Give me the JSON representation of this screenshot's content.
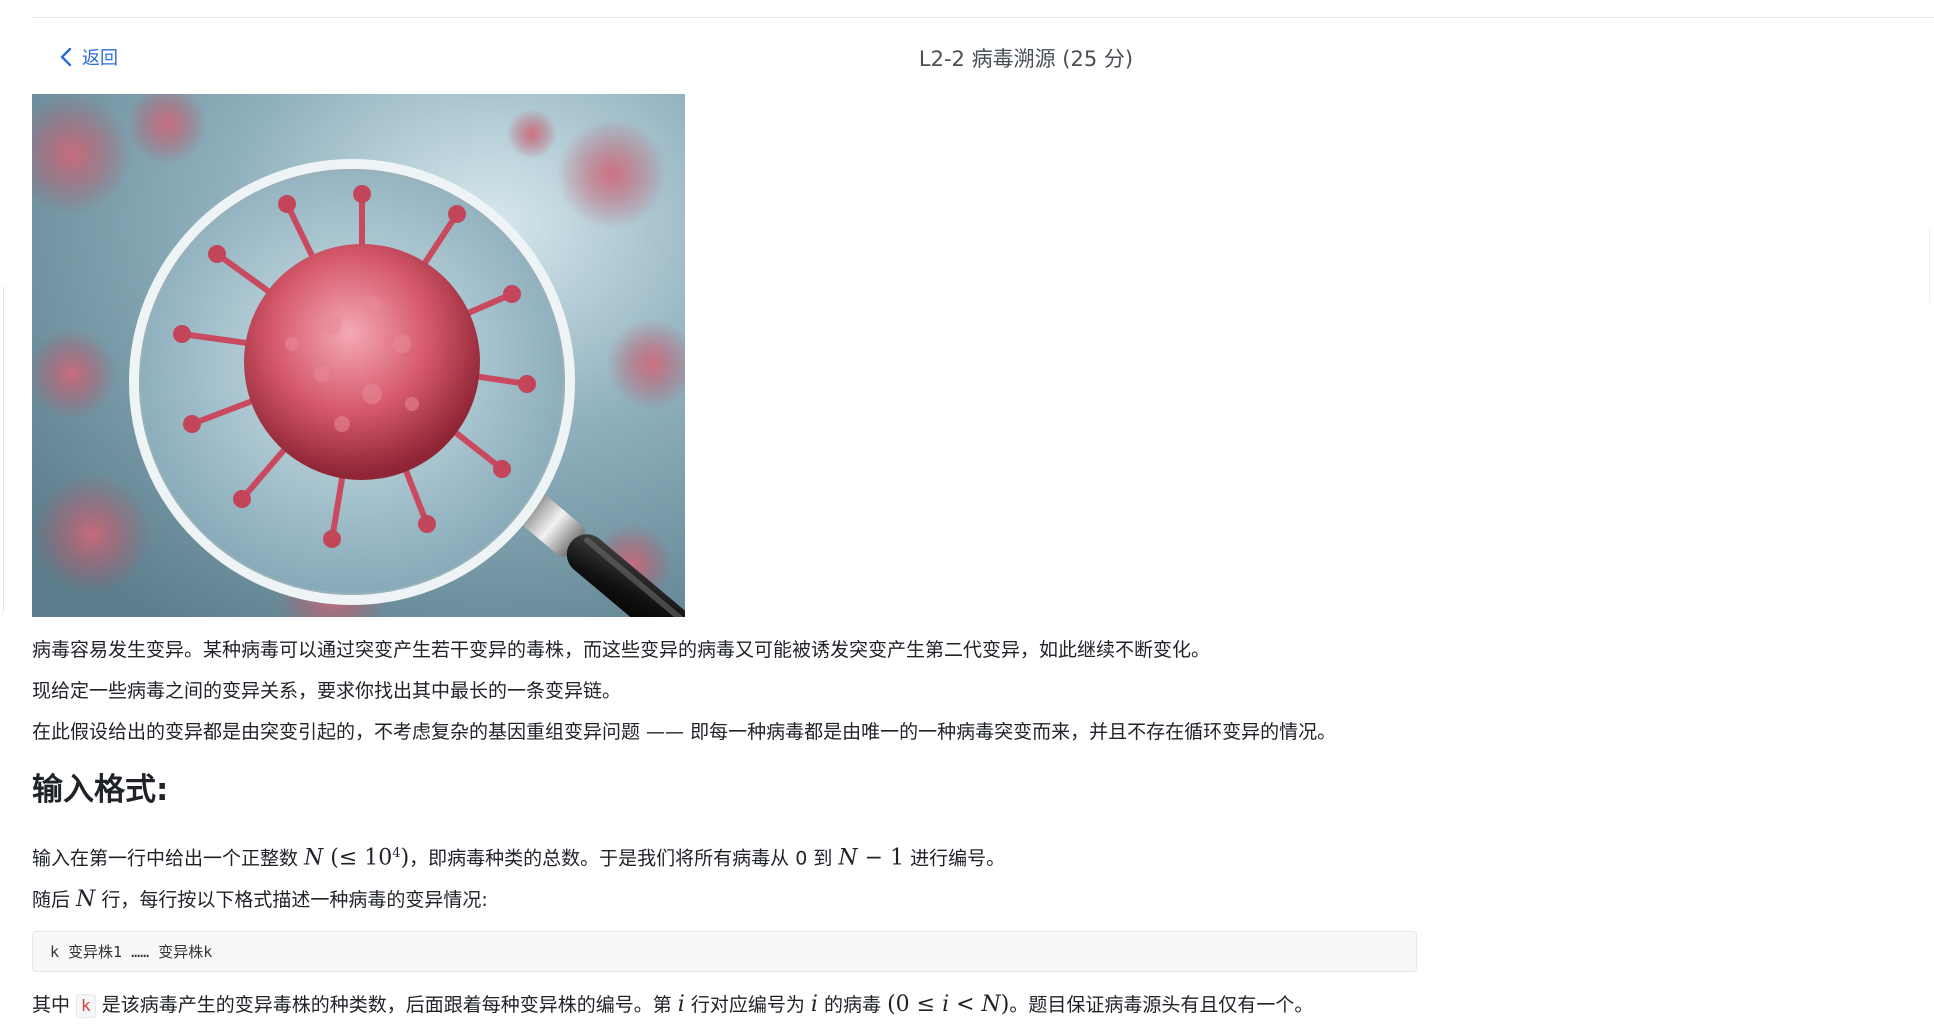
{
  "header": {
    "back_label": "返回",
    "title": "L2-2 病毒溯源 (25 分)"
  },
  "problem": {
    "paragraph_1": "病毒容易发生变异。某种病毒可以通过突变产生若干变异的毒株，而这些变异的病毒又可能被诱发突变产生第二代变异，如此继续不断变化。",
    "paragraph_2": "现给定一些病毒之间的变异关系，要求你找出其中最长的一条变异链。",
    "paragraph_3": "在此假设给出的变异都是由突变引起的，不考虑复杂的基因重组变异问题 —— 即每一种病毒都是由唯一的一种病毒突变而来，并且不存在循环变异的情况。",
    "input_heading": "输入格式:",
    "input_line_1": {
      "t1": "输入在第一行中给出一个正整数 ",
      "m1": "N",
      "m2": " (≤ 10",
      "m3": "4",
      "m4": ")",
      "t2": "，即病毒种类的总数。于是我们将所有病毒从 0 到 ",
      "m5": "N",
      "m6": " − 1",
      "t3": " 进行编号。"
    },
    "input_line_2": {
      "t1": "随后 ",
      "m1": "N",
      "t2": " 行，每行按以下格式描述一种病毒的变异情况:"
    },
    "code_sample": "k 变异株1 …… 变异株k",
    "input_line_3": {
      "t1": "其中 ",
      "code": "k",
      "t2": " 是该病毒产生的变异毒株的种类数，后面跟着每种变异株的编号。第 ",
      "m1": "i",
      "t3": " 行对应编号为 ",
      "m2": "i",
      "t4": " 的病毒 ",
      "m3": "(0 ≤ ",
      "m4": "i",
      "m5": " < ",
      "m6": "N",
      "m7": ")",
      "t5": "。题目保证病毒源头有且仅有一个。"
    }
  },
  "icons": {
    "back": "chevron-left-icon"
  },
  "colors": {
    "link": "#2b6cdb",
    "inline_code": "#d43b3b"
  }
}
